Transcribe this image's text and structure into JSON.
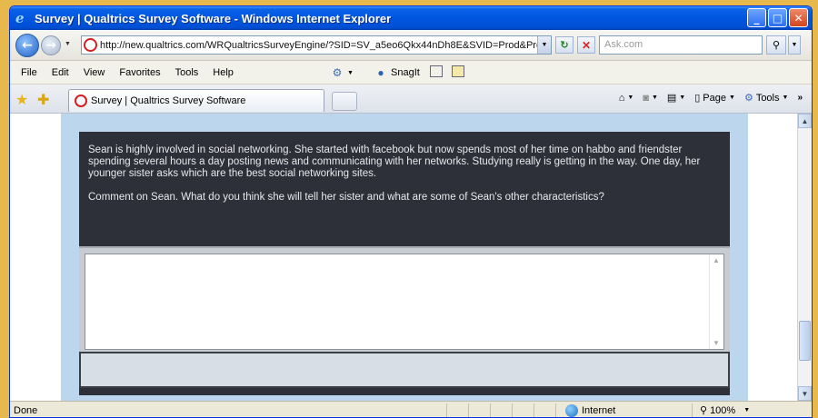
{
  "window": {
    "title": "Survey | Qualtrics Survey Software - Windows Internet Explorer",
    "minimize": "_",
    "maximize": "□",
    "close": "✕"
  },
  "address": {
    "url": "http://new.qualtrics.com/WRQualtricsSurveyEngine/?SID=SV_a5eo6Qkx44nDh8E&SVID=Prod&Pre",
    "search_placeholder": "Ask.com"
  },
  "menu": {
    "items": [
      "File",
      "Edit",
      "View",
      "Favorites",
      "Tools",
      "Help"
    ],
    "snagit_label": "SnagIt"
  },
  "tabs": {
    "active_label": "Survey | Qualtrics Survey Software"
  },
  "command_bar": {
    "page_label": "Page",
    "tools_label": "Tools"
  },
  "question": {
    "paragraph1": "Sean is highly involved in social networking.  She started with facebook but now spends most of her time on habbo and friendster spending several hours a day posting news and communicating with her networks.  Studying really is getting in the way.  One day, her younger sister asks which are the best social networking sites.",
    "paragraph2": "Comment on Sean.  What do you think she will tell her sister and what are some of Sean's other characteristics?",
    "answer_value": ""
  },
  "status": {
    "text": "Done",
    "zone": "Internet",
    "zoom": "100%"
  },
  "colors": {
    "title_bar": "#0056e0",
    "question_bg": "#2d3039",
    "panel_bg": "#bcd6ee"
  }
}
